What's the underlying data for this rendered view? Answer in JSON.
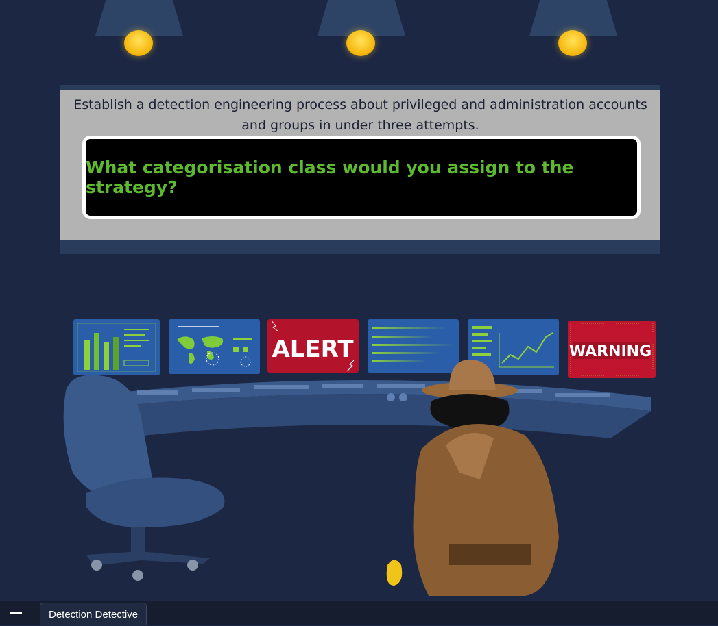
{
  "game": {
    "prompt": "Establish a detection engineering process about privileged and administration accounts and groups in under three attempts.",
    "question": "What categorisation class would you assign to the strategy?"
  },
  "scene": {
    "monitor_alert": "ALERT",
    "monitor_warning": "WARNING",
    "lamp_count": 3
  },
  "taskbar": {
    "minimize_icon": "minimize-icon",
    "app_tab": "Detection Detective"
  },
  "colors": {
    "background": "#1c2744",
    "panel": "#b3b3b3",
    "question_text": "#5dba2f",
    "alert_red": "#b3142c"
  }
}
